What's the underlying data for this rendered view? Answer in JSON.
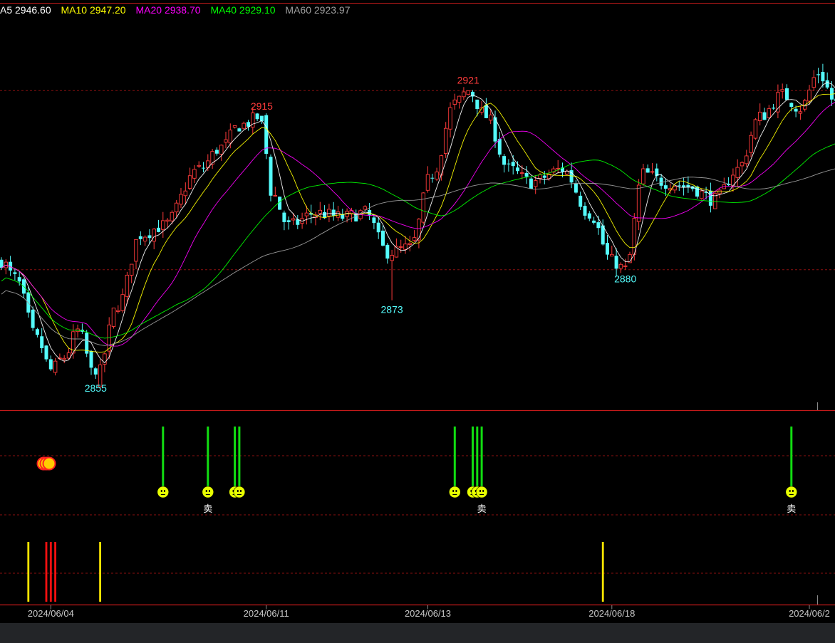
{
  "legend": {
    "ma5": "A5 2946.60",
    "ma10": "MA10 2947.20",
    "ma20": "MA20 2938.70",
    "ma40": "MA40 2929.10",
    "ma60": "MA60 2923.97"
  },
  "colors": {
    "up": "#ff3b3b",
    "down": "#54fcfc",
    "ma5": "#ffffff",
    "ma10": "#ffff00",
    "ma20": "#ff00ff",
    "ma40": "#00ff00",
    "ma60": "#a0a0a0",
    "grid": "#8b1111",
    "panel_border": "#c41a1a",
    "axis_text": "#c8c8c8",
    "high_label": "#ff3b3b",
    "low_label": "#54fcfc"
  },
  "chart_data": {
    "type": "candlestick",
    "ylim": [
      2848,
      2938
    ],
    "ref_levels": [
      2921,
      2880
    ],
    "x_ticks": [
      {
        "label": "2024/06/04",
        "index": 11
      },
      {
        "label": "2024/06/11",
        "index": 59
      },
      {
        "label": "2024/06/13",
        "index": 95
      },
      {
        "label": "2024/06/18",
        "index": 136
      },
      {
        "label": "2024/06/2",
        "index": 180
      }
    ],
    "n_bars": 187,
    "price_anchors": [
      [
        0,
        2882
      ],
      [
        3,
        2878
      ],
      [
        8,
        2864
      ],
      [
        11,
        2857
      ],
      [
        14,
        2860
      ],
      [
        17,
        2866
      ],
      [
        21,
        2855
      ],
      [
        26,
        2872
      ],
      [
        31,
        2888
      ],
      [
        36,
        2890
      ],
      [
        44,
        2903
      ],
      [
        49,
        2908
      ],
      [
        53,
        2913
      ],
      [
        58,
        2915
      ],
      [
        60,
        2898
      ],
      [
        64,
        2890
      ],
      [
        70,
        2893
      ],
      [
        76,
        2892
      ],
      [
        81,
        2893
      ],
      [
        86,
        2884
      ],
      [
        91,
        2885
      ],
      [
        96,
        2902
      ],
      [
        101,
        2918
      ],
      [
        104,
        2921
      ],
      [
        108,
        2915
      ],
      [
        113,
        2903
      ],
      [
        118,
        2900
      ],
      [
        125,
        2903
      ],
      [
        131,
        2893
      ],
      [
        136,
        2882
      ],
      [
        139,
        2880
      ],
      [
        143,
        2902
      ],
      [
        148,
        2900
      ],
      [
        153,
        2899
      ],
      [
        159,
        2896
      ],
      [
        164,
        2903
      ],
      [
        169,
        2915
      ],
      [
        174,
        2920
      ],
      [
        178,
        2917
      ],
      [
        182,
        2925
      ],
      [
        186,
        2918
      ]
    ],
    "high_labels": [
      {
        "text": "2915",
        "index": 58,
        "value": 2915
      },
      {
        "text": "2921",
        "index": 104,
        "value": 2921
      }
    ],
    "low_labels": [
      {
        "text": "2855",
        "index": 21,
        "value": 2855
      },
      {
        "text": "2873",
        "index": 87,
        "value": 2873
      },
      {
        "text": "2880",
        "index": 139,
        "value": 2880
      }
    ]
  },
  "signals": {
    "cluster_icon_index": 10,
    "sell_label": "卖",
    "green_marks": [
      {
        "index": 36,
        "sell": false
      },
      {
        "index": 46,
        "sell": true
      },
      {
        "index": 52,
        "sell": false
      },
      {
        "index": 53,
        "sell": false
      },
      {
        "index": 101,
        "sell": false
      },
      {
        "index": 105,
        "sell": false
      },
      {
        "index": 106,
        "sell": false
      },
      {
        "index": 107,
        "sell": true
      },
      {
        "index": 176,
        "sell": true
      }
    ],
    "bars": [
      {
        "index": 6,
        "color": "yellow"
      },
      {
        "index": 10,
        "color": "red"
      },
      {
        "index": 11,
        "color": "red"
      },
      {
        "index": 12,
        "color": "red"
      },
      {
        "index": 22,
        "color": "yellow"
      },
      {
        "index": 134,
        "color": "yellow"
      }
    ]
  }
}
